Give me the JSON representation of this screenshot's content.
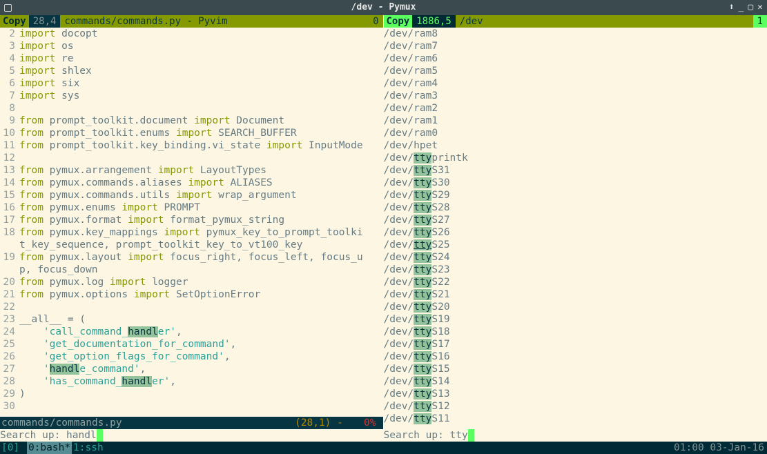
{
  "window": {
    "title": "/dev - Pymux"
  },
  "left": {
    "copy_label": "Copy",
    "cursor_pos": "28,4",
    "tab_label": "commands/commands.py - Pyvim",
    "tab_count": "0",
    "lines": [
      {
        "n": 2,
        "tokens": [
          [
            "kw",
            "import"
          ],
          [
            "",
            " docopt"
          ]
        ]
      },
      {
        "n": 3,
        "tokens": [
          [
            "kw",
            "import"
          ],
          [
            "",
            " os"
          ]
        ]
      },
      {
        "n": 4,
        "tokens": [
          [
            "kw",
            "import"
          ],
          [
            "",
            " re"
          ]
        ]
      },
      {
        "n": 5,
        "tokens": [
          [
            "kw",
            "import"
          ],
          [
            "",
            " shlex"
          ]
        ]
      },
      {
        "n": 6,
        "tokens": [
          [
            "kw",
            "import"
          ],
          [
            "",
            " six"
          ]
        ]
      },
      {
        "n": 7,
        "tokens": [
          [
            "kw",
            "import"
          ],
          [
            "",
            " sys"
          ]
        ]
      },
      {
        "n": 8,
        "tokens": []
      },
      {
        "n": 9,
        "tokens": [
          [
            "kw",
            "from"
          ],
          [
            "",
            " prompt_toolkit.document "
          ],
          [
            "kw",
            "import"
          ],
          [
            "",
            " Document"
          ]
        ]
      },
      {
        "n": 10,
        "tokens": [
          [
            "kw",
            "from"
          ],
          [
            "",
            " prompt_toolkit.enums "
          ],
          [
            "kw",
            "import"
          ],
          [
            "",
            " SEARCH_BUFFER"
          ]
        ]
      },
      {
        "n": 11,
        "tokens": [
          [
            "kw",
            "from"
          ],
          [
            "",
            " prompt_toolkit.key_binding.vi_state "
          ],
          [
            "kw",
            "import"
          ],
          [
            "",
            " InputMode"
          ]
        ]
      },
      {
        "n": 12,
        "tokens": []
      },
      {
        "n": 13,
        "tokens": [
          [
            "kw",
            "from"
          ],
          [
            "",
            " pymux.arrangement "
          ],
          [
            "kw",
            "import"
          ],
          [
            "",
            " LayoutTypes"
          ]
        ]
      },
      {
        "n": 14,
        "tokens": [
          [
            "kw",
            "from"
          ],
          [
            "",
            " pymux.commands.aliases "
          ],
          [
            "kw",
            "import"
          ],
          [
            "",
            " ALIASES"
          ]
        ]
      },
      {
        "n": 15,
        "tokens": [
          [
            "kw",
            "from"
          ],
          [
            "",
            " pymux.commands.utils "
          ],
          [
            "kw",
            "import"
          ],
          [
            "",
            " wrap_argument"
          ]
        ]
      },
      {
        "n": 16,
        "tokens": [
          [
            "kw",
            "from"
          ],
          [
            "",
            " pymux.enums "
          ],
          [
            "kw",
            "import"
          ],
          [
            "",
            " PROMPT"
          ]
        ]
      },
      {
        "n": 17,
        "tokens": [
          [
            "kw",
            "from"
          ],
          [
            "",
            " pymux.format "
          ],
          [
            "kw",
            "import"
          ],
          [
            "",
            " format_pymux_string"
          ]
        ]
      },
      {
        "n": 18,
        "tokens": [
          [
            "kw",
            "from"
          ],
          [
            "",
            " pymux.key_mappings "
          ],
          [
            "kw",
            "import"
          ],
          [
            "",
            " pymux_key_to_prompt_toolki"
          ]
        ]
      },
      {
        "n": null,
        "tokens": [
          [
            "",
            "t_key_sequence, prompt_toolkit_key_to_vt100_key"
          ]
        ]
      },
      {
        "n": 19,
        "tokens": [
          [
            "kw",
            "from"
          ],
          [
            "",
            " pymux.layout "
          ],
          [
            "kw",
            "import"
          ],
          [
            "",
            " focus_right, focus_left, focus_u"
          ]
        ]
      },
      {
        "n": null,
        "tokens": [
          [
            "",
            "p, focus_down"
          ]
        ]
      },
      {
        "n": 20,
        "tokens": [
          [
            "kw",
            "from"
          ],
          [
            "",
            " pymux.log "
          ],
          [
            "kw",
            "import"
          ],
          [
            "",
            " logger"
          ]
        ]
      },
      {
        "n": 21,
        "tokens": [
          [
            "kw",
            "from"
          ],
          [
            "",
            " pymux.options "
          ],
          [
            "kw",
            "import"
          ],
          [
            "",
            " SetOptionError"
          ]
        ]
      },
      {
        "n": 22,
        "tokens": []
      },
      {
        "n": 23,
        "tokens": [
          [
            "",
            "__all__ = ("
          ]
        ]
      },
      {
        "n": 24,
        "tokens": [
          [
            "",
            "    "
          ],
          [
            "str",
            "'call_command_"
          ],
          [
            "hl",
            "handl"
          ],
          [
            "str",
            "er'"
          ],
          [
            "",
            ","
          ]
        ]
      },
      {
        "n": 25,
        "tokens": [
          [
            "",
            "    "
          ],
          [
            "str",
            "'get_documentation_for_command'"
          ],
          [
            "",
            ","
          ]
        ]
      },
      {
        "n": 26,
        "tokens": [
          [
            "",
            "    "
          ],
          [
            "str",
            "'get_option_flags_for_command'"
          ],
          [
            "",
            ","
          ]
        ]
      },
      {
        "n": 27,
        "tokens": [
          [
            "",
            "    "
          ],
          [
            "str",
            "'"
          ],
          [
            "hl",
            "handl"
          ],
          [
            "str",
            "e_command'"
          ],
          [
            "",
            ","
          ]
        ]
      },
      {
        "n": 28,
        "tokens": [
          [
            "",
            "    "
          ],
          [
            "str",
            "'has_command_"
          ],
          [
            "hl",
            "handl"
          ],
          [
            "str",
            "er'"
          ],
          [
            "",
            ","
          ]
        ]
      },
      {
        "n": 29,
        "tokens": [
          [
            "",
            ")"
          ]
        ]
      },
      {
        "n": 30,
        "tokens": []
      }
    ],
    "status_file": "commands/commands.py",
    "status_pos": "(28,1) - ",
    "status_pct": "  0%",
    "search_label": "Search up: ",
    "search_query": "handl"
  },
  "right": {
    "copy_label": "Copy",
    "cursor_pos": "1886,5",
    "tab_label": "/dev",
    "tab_count": "1",
    "lines": [
      {
        "pre": "/dev/ram8",
        "hl": "",
        "post": ""
      },
      {
        "pre": "/dev/ram7",
        "hl": "",
        "post": ""
      },
      {
        "pre": "/dev/ram6",
        "hl": "",
        "post": ""
      },
      {
        "pre": "/dev/ram5",
        "hl": "",
        "post": ""
      },
      {
        "pre": "/dev/ram4",
        "hl": "",
        "post": ""
      },
      {
        "pre": "/dev/ram3",
        "hl": "",
        "post": ""
      },
      {
        "pre": "/dev/ram2",
        "hl": "",
        "post": ""
      },
      {
        "pre": "/dev/ram1",
        "hl": "",
        "post": ""
      },
      {
        "pre": "/dev/ram0",
        "hl": "",
        "post": ""
      },
      {
        "pre": "/dev/hpet",
        "hl": "",
        "post": ""
      },
      {
        "pre": "/dev/",
        "hl": "tty",
        "post": "printk"
      },
      {
        "pre": "/dev/",
        "hl": "tty",
        "post": "S31"
      },
      {
        "pre": "/dev/",
        "hl": "tty",
        "post": "S30"
      },
      {
        "pre": "/dev/",
        "hl": "tty",
        "post": "S29"
      },
      {
        "pre": "/dev/",
        "hl": "tty",
        "post": "S28"
      },
      {
        "pre": "/dev/",
        "hl": "tty",
        "post": "S27"
      },
      {
        "pre": "/dev/",
        "hl": "tty",
        "post": "S26"
      },
      {
        "pre": "/dev/",
        "hl": "tty",
        "post": "S25",
        "ul": true
      },
      {
        "pre": "/dev/",
        "hl": "tty",
        "post": "S24"
      },
      {
        "pre": "/dev/",
        "hl": "tty",
        "post": "S23"
      },
      {
        "pre": "/dev/",
        "hl": "tty",
        "post": "S22"
      },
      {
        "pre": "/dev/",
        "hl": "tty",
        "post": "S21"
      },
      {
        "pre": "/dev/",
        "hl": "tty",
        "post": "S20"
      },
      {
        "pre": "/dev/",
        "hl": "tty",
        "post": "S19"
      },
      {
        "pre": "/dev/",
        "hl": "tty",
        "post": "S18"
      },
      {
        "pre": "/dev/",
        "hl": "tty",
        "post": "S17"
      },
      {
        "pre": "/dev/",
        "hl": "tty",
        "post": "S16"
      },
      {
        "pre": "/dev/",
        "hl": "tty",
        "post": "S15"
      },
      {
        "pre": "/dev/",
        "hl": "tty",
        "post": "S14"
      },
      {
        "pre": "/dev/",
        "hl": "tty",
        "post": "S13"
      },
      {
        "pre": "/dev/",
        "hl": "tty",
        "post": "S12"
      },
      {
        "pre": "/dev/",
        "hl": "tty",
        "post": "S11"
      }
    ],
    "search_label": "Search up: ",
    "search_query": "tty"
  },
  "bottom": {
    "session": "[0]",
    "win_active": "0:bash*",
    "win_inactive": "1:ssh",
    "clock": "01:00 03-Jan-16"
  }
}
